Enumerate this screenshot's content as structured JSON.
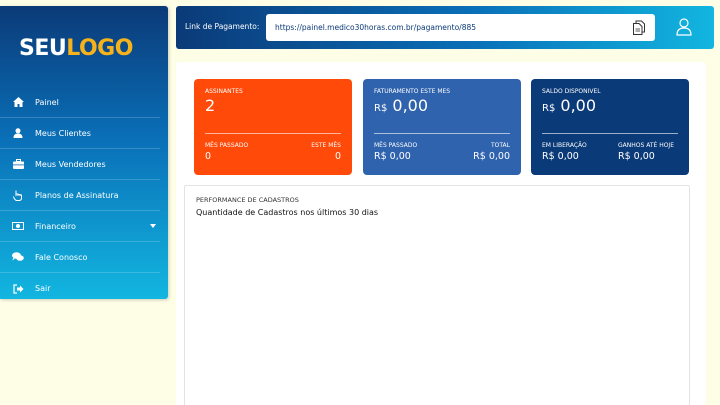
{
  "logo": {
    "part1": "SEU",
    "part2": "LOGO"
  },
  "sidebar": {
    "items": [
      {
        "label": "Painel",
        "icon": "home-icon"
      },
      {
        "label": "Meus Clientes",
        "icon": "user-icon"
      },
      {
        "label": "Meus Vendedores",
        "icon": "briefcase-icon"
      },
      {
        "label": "Planos de Assinatura",
        "icon": "hand-pointer-icon"
      },
      {
        "label": "Financeiro",
        "icon": "money-icon"
      },
      {
        "label": "Fale Conosco",
        "icon": "chat-icon"
      },
      {
        "label": "Sair",
        "icon": "sign-out-icon"
      }
    ]
  },
  "topbar": {
    "link_label": "Link de Pagamento:",
    "link_url": "https://painel.medico30horas.com.br/pagamento/885"
  },
  "cards": {
    "assinantes": {
      "label": "ASSINANTES",
      "value": "2",
      "left_label": "MÊS PASSADO",
      "left_value": "0",
      "right_label": "ESTE MÊS",
      "right_value": "0"
    },
    "faturamento": {
      "label": "FATURAMENTO ESTE MES",
      "currency": "R$",
      "value": "0,00",
      "left_label": "MÊS PASSADO",
      "left_value": "R$ 0,00",
      "right_label": "TOTAL",
      "right_value": "R$ 0,00"
    },
    "saldo": {
      "label": "SALDO DISPONIVEL",
      "currency": "R$",
      "value": "0,00",
      "left_label": "EM LIBERAÇÃO",
      "left_value": "R$ 0,00",
      "right_label": "GANHOS ATÉ HOJE",
      "right_value": "R$ 0,00"
    }
  },
  "performance": {
    "title": "PERFORMANCE DE CADASTROS",
    "subtitle": "Quantidade de Cadastros nos últimos 30 dias"
  },
  "colors": {
    "assinantes": "#ff4a0a",
    "faturamento": "#2f63ae",
    "saldo": "#0b3a78",
    "logo_accent": "#f6b21b"
  }
}
